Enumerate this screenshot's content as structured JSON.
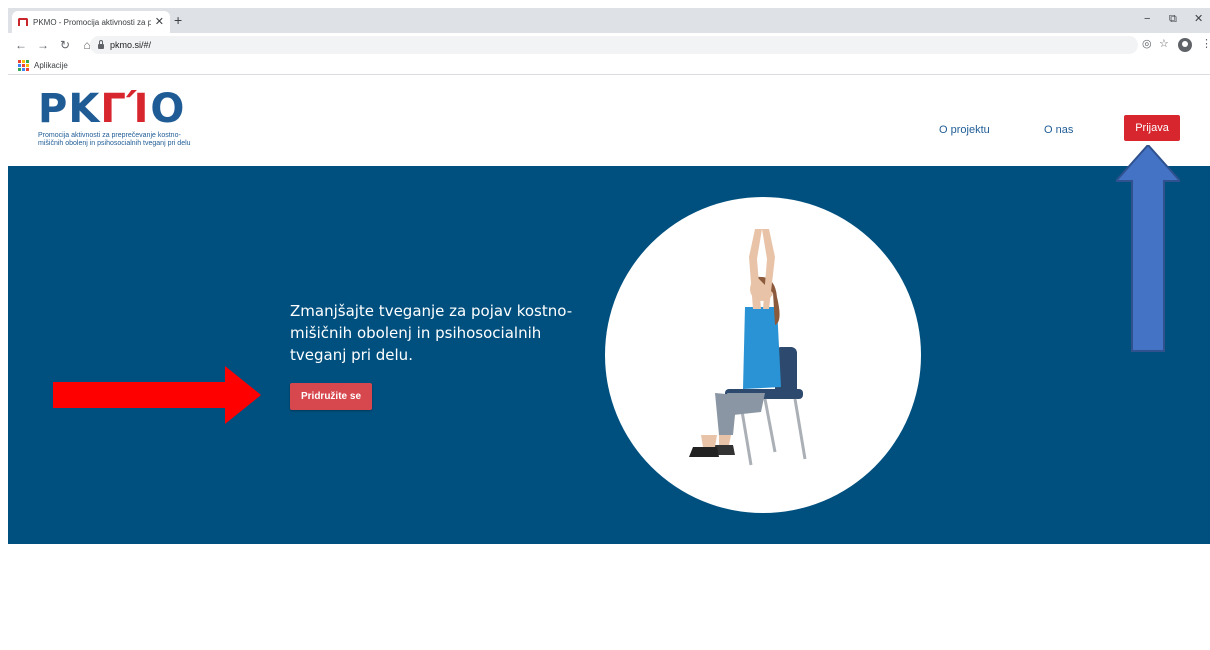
{
  "browser": {
    "tab_title": "PKMO - Promocija aktivnosti za p",
    "tab_close": "✕",
    "new_tab": "+",
    "url": "pkmo.si/#/",
    "bookmark_apps_label": "Aplikacije",
    "window_controls": {
      "minimize": "−",
      "restore": "⧉",
      "close": "✕"
    },
    "nav": {
      "back": "←",
      "forward": "→",
      "reload": "↻",
      "home": "⌂"
    },
    "toolbar_icons": {
      "eye_off": "◎",
      "star": "☆",
      "menu": "⋮"
    }
  },
  "site": {
    "logo_text": "PK",
    "logo_text_mid": "ΓΊ",
    "logo_text_end": "O",
    "logo_subtitle": "Promocija aktivnosti za preprečevanje kostno-mišičnih obolenj in psihosocialnih tveganj pri delu",
    "nav": {
      "project": "O projektu",
      "about": "O nas",
      "login": "Prijava"
    },
    "hero": {
      "heading": "Zmanjšajte tveganje za pojav kostno-mišičnih obolenj in psihosocialnih tveganj pri delu.",
      "cta": "Pridružite se"
    }
  },
  "colors": {
    "brand_blue": "#1f5c96",
    "hero_bg": "#00507f",
    "accent_red": "#d7262e",
    "annotation_red": "#ff0000",
    "annotation_blue": "#4472c4"
  }
}
